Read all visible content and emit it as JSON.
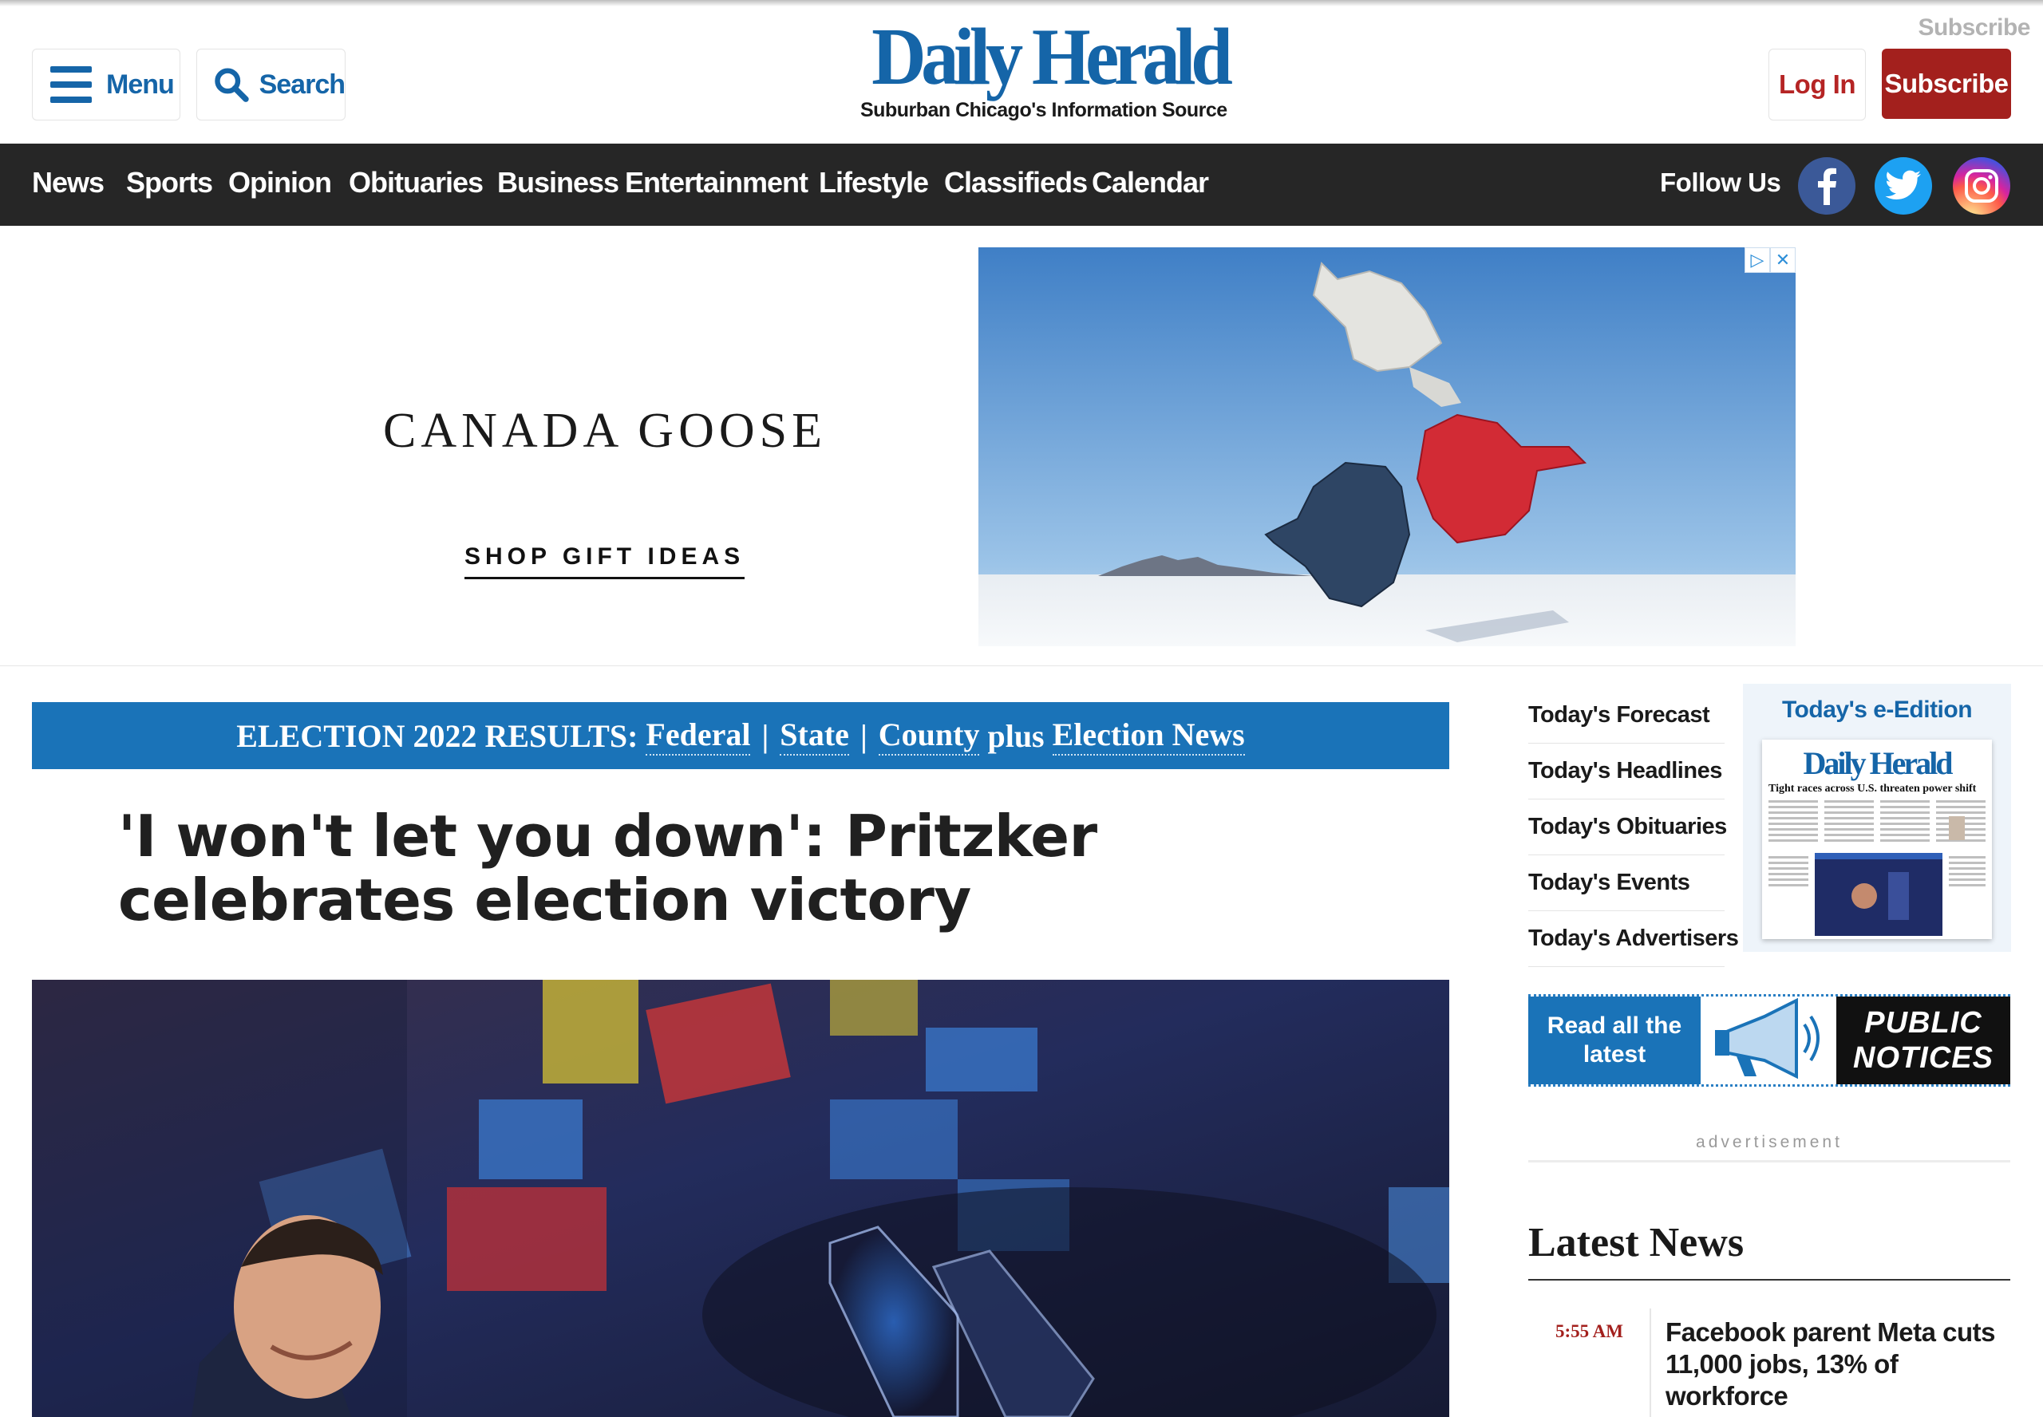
{
  "header": {
    "menu_label": "Menu",
    "search_label": "Search",
    "logo_text": "Daily Herald",
    "logo_tagline": "Suburban Chicago's Information Source",
    "subscribe_small": "Subscribe",
    "login_label": "Log In",
    "subscribe_label": "Subscribe"
  },
  "nav": {
    "items": [
      "News",
      "Sports",
      "Opinion",
      "Obituaries",
      "Business",
      "Entertainment",
      "Lifestyle",
      "Classifieds",
      "Calendar"
    ],
    "follow_label": "Follow Us",
    "social": [
      "facebook-icon",
      "twitter-icon",
      "instagram-icon"
    ]
  },
  "ad": {
    "brand": "CANADA GOOSE",
    "cta": "SHOP GIFT IDEAS"
  },
  "election": {
    "prefix": "ELECTION 2022 RESULTS:",
    "federal": "Federal",
    "sep1": "|",
    "state": "State",
    "sep2": "|",
    "county": "County",
    "plus": "plus",
    "news": "Election News"
  },
  "article": {
    "headline": "'I won't let you down': Pritzker celebrates election victory"
  },
  "rail": {
    "quick_links": [
      "Today's Forecast",
      "Today's Headlines",
      "Today's Obituaries",
      "Today's Events",
      "Today's Advertisers"
    ],
    "eedition_title": "Today's e-Edition",
    "paper_logo": "Daily Herald",
    "paper_headline": "Tight races across U.S. threaten power shift",
    "notices_left": "Read all the latest",
    "notices_right": "PUBLIC NOTICES",
    "advertisement_label": "advertisement",
    "latest_title": "Latest News",
    "latest": [
      {
        "time": "5:55 AM",
        "text": "Facebook parent Meta cuts 11,000 jobs, 13% of workforce"
      }
    ]
  },
  "colors": {
    "brand_blue": "#1565a8",
    "nav_bg": "#262626",
    "subscribe_red": "#a3201d",
    "election_blue": "#1a73b8"
  }
}
